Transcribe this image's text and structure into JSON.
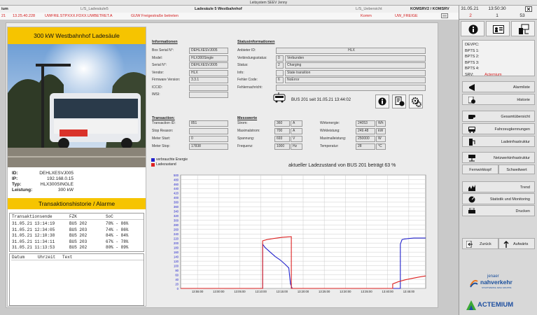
{
  "window_title": "Leitsystem SEEV Jenny",
  "topbar": {
    "row1": {
      "left": "ium",
      "center_tag": "L/S_Ladesäule5",
      "title": "Ladesäule 5 Westbahnhof",
      "right_tag": "L/S_Uebersicht",
      "servers": "KOMSRV2 / KOMSRV"
    },
    "row2": {
      "num": "21",
      "time": "13.25.40.228",
      "code": "UWFRE.STPXXX.FDXX.UWBETRET.A",
      "message": "GUW Freigestraße betreten",
      "status": "Komm",
      "tag": "UW_FREIGE"
    }
  },
  "clock": {
    "date": "31.05.21",
    "time": "13:50:30",
    "a": "2",
    "b": "1",
    "c": "53"
  },
  "station": {
    "title": "300 kW Westbahnhof Ladesäule",
    "id_label": "ID:",
    "id": "DEHLXESVJ005",
    "ip_label": "IP:",
    "ip": "192.168.0.15",
    "typ_label": "Typ:",
    "typ": "HLX300SINGLE",
    "power_label": "Leistung:",
    "power": "300 kW"
  },
  "history": {
    "title": "Transaktionshistorie / Alarme",
    "columns": [
      "Transaktionsende",
      "FZK",
      "SoC"
    ],
    "rows": [
      [
        "31.05.21 13:14:19",
        "BUS 202",
        "78% - 86%"
      ],
      [
        "31.05.21 12:34:05",
        "BUS 203",
        "74% - 86%"
      ],
      [
        "31.05.21 12:10:38",
        "BUS 202",
        "84% - 84%"
      ],
      [
        "31.05.21 11:34:11",
        "BUS 203",
        "67% - 78%"
      ],
      [
        "31.05.21 11:13:53",
        "BUS 202",
        "80% - 89%"
      ]
    ],
    "alarm_columns": [
      "Datum",
      "Uhrzeit",
      "Text"
    ]
  },
  "info": {
    "title": "Informationen",
    "fields": [
      {
        "label": "Box Serial N°:",
        "value": "DEHLXESVJ005"
      },
      {
        "label": "Model:",
        "value": "HLX300Single"
      },
      {
        "label": "Serial N°:",
        "value": "DEHLXESVJ005"
      },
      {
        "label": "Vendor:",
        "value": "HLX"
      },
      {
        "label": "Firmware Version:",
        "value": "3.3.1"
      },
      {
        "label": "ICCID:",
        "value": ""
      },
      {
        "label": "IMSI:",
        "value": ""
      }
    ]
  },
  "status": {
    "title": "Statusinformationen",
    "fields": [
      {
        "label": "Anbieter ID:",
        "num": "",
        "value": "HLX"
      },
      {
        "label": "Verbindungsstatus:",
        "num": "0",
        "value": "Verbunden"
      },
      {
        "label": "Status:",
        "num": "2",
        "value": "Charging"
      },
      {
        "label": "Info:",
        "num": "",
        "value": "State transition"
      },
      {
        "label": "Fehler Code:",
        "num": "6",
        "value": "NoError"
      },
      {
        "label": "Fehlernachricht:",
        "num": "",
        "value": ""
      }
    ],
    "bus_text": "BUS 201  seit  31.05.21 13:44:02"
  },
  "transaction": {
    "title": "Transaction:",
    "fields": [
      {
        "label": "Transaction ID:",
        "value": "851"
      },
      {
        "label": "Stop Reason:",
        "value": ""
      },
      {
        "label": "Meter Start:",
        "value": "0"
      },
      {
        "label": "Meter Stop:",
        "value": "17838"
      }
    ]
  },
  "measurements": {
    "title": "Messwerte",
    "left": [
      {
        "label": "Strom:",
        "value": "360",
        "unit": "A"
      },
      {
        "label": "Maximalstrom:",
        "value": "700",
        "unit": "A"
      },
      {
        "label": "Spannung:",
        "value": "693",
        "unit": "V"
      },
      {
        "label": "Frequenz:",
        "value": "1000",
        "unit": "Hz"
      }
    ],
    "right": [
      {
        "label": "Wirkenergie:",
        "value": "24053",
        "unit": "Wh"
      },
      {
        "label": "Wirkleistung:",
        "value": "249.48",
        "unit": "kW"
      },
      {
        "label": "Maximalleistung:",
        "value": "250000",
        "unit": "W"
      },
      {
        "label": "Temperatur:",
        "value": "28",
        "unit": "°C"
      }
    ]
  },
  "chart_data": {
    "type": "line",
    "title": "aktueller Ladezustand von BUS 201 beträgt  63 %",
    "series": [
      {
        "name": "verbrauchte Energie",
        "color": "#2222cc",
        "points": [
          [
            0,
            0
          ],
          [
            97,
            0
          ],
          [
            97,
            195
          ],
          [
            100,
            180
          ],
          [
            106,
            160
          ],
          [
            112,
            140
          ],
          [
            118,
            125
          ],
          [
            124,
            105
          ],
          [
            128,
            90
          ],
          [
            130,
            20
          ],
          [
            132,
            0
          ],
          [
            260,
            0
          ],
          [
            260,
            195
          ],
          [
            262,
            215
          ],
          [
            265,
            218
          ],
          [
            270,
            220
          ],
          [
            276,
            222
          ],
          [
            282,
            222
          ],
          [
            290,
            222
          ]
        ]
      },
      {
        "name": "Ladezustand",
        "color": "#dd2222",
        "points": [
          [
            0,
            0
          ],
          [
            97,
            0
          ],
          [
            97,
            210
          ],
          [
            102,
            215
          ],
          [
            110,
            220
          ],
          [
            120,
            225
          ],
          [
            131,
            228
          ],
          [
            131,
            0
          ],
          [
            251,
            0
          ],
          [
            251,
            20
          ],
          [
            258,
            30
          ],
          [
            266,
            38
          ],
          [
            274,
            44
          ],
          [
            282,
            50
          ],
          [
            290,
            55
          ]
        ]
      }
    ],
    "ylim": [
      0,
      500
    ],
    "xlim": [
      0,
      290
    ],
    "yticks": [
      0,
      20,
      40,
      60,
      80,
      100,
      120,
      140,
      160,
      180,
      200,
      220,
      240,
      260,
      280,
      300,
      320,
      340,
      360,
      380,
      400,
      420,
      440,
      460,
      480,
      500
    ],
    "xticks": [
      {
        "pos": 20,
        "label": "13:55:00"
      },
      {
        "pos": 45,
        "label": "13:00:00"
      },
      {
        "pos": 70,
        "label": "13:05:00"
      },
      {
        "pos": 95,
        "label": "13:10:00"
      },
      {
        "pos": 120,
        "label": "13:15:00"
      },
      {
        "pos": 145,
        "label": "13:20:00"
      },
      {
        "pos": 170,
        "label": "13:25:00"
      },
      {
        "pos": 195,
        "label": "13:30:00"
      },
      {
        "pos": 220,
        "label": "13:35:00"
      },
      {
        "pos": 245,
        "label": "13:40:00"
      },
      {
        "pos": 270,
        "label": "13:45:00"
      }
    ]
  },
  "sidebar": {
    "devices": [
      "DEVPC:",
      "BPTS 1:",
      "BPTS 2:",
      "BPTS 3:",
      "BPTS 4:"
    ],
    "srv_label": "SRV:",
    "srv_value": "Actemium",
    "buttons": [
      "Alarmliste",
      "Historie",
      "Gesamtübersicht",
      "Fahrzeugkennungen",
      "Ladeinfrastruktur",
      "Netzwerkinfrastruktur",
      "Fernwirkkopf",
      "Schweilwert",
      "Trend",
      "Statistik und Monitoring",
      "Drucken",
      "Zurück",
      "Aufwärts"
    ]
  },
  "logos": {
    "jenaer_top": "jenaer",
    "jenaer_main": "nahverkehr",
    "jenaer_sub": "STADTWERKE JENA GRUPPE",
    "actemium": "ACTEMIUM"
  },
  "colors": {
    "accent_yellow": "#f6c400",
    "alarm_red": "#d42020",
    "series_blue": "#2222cc",
    "series_red": "#dd2222"
  }
}
